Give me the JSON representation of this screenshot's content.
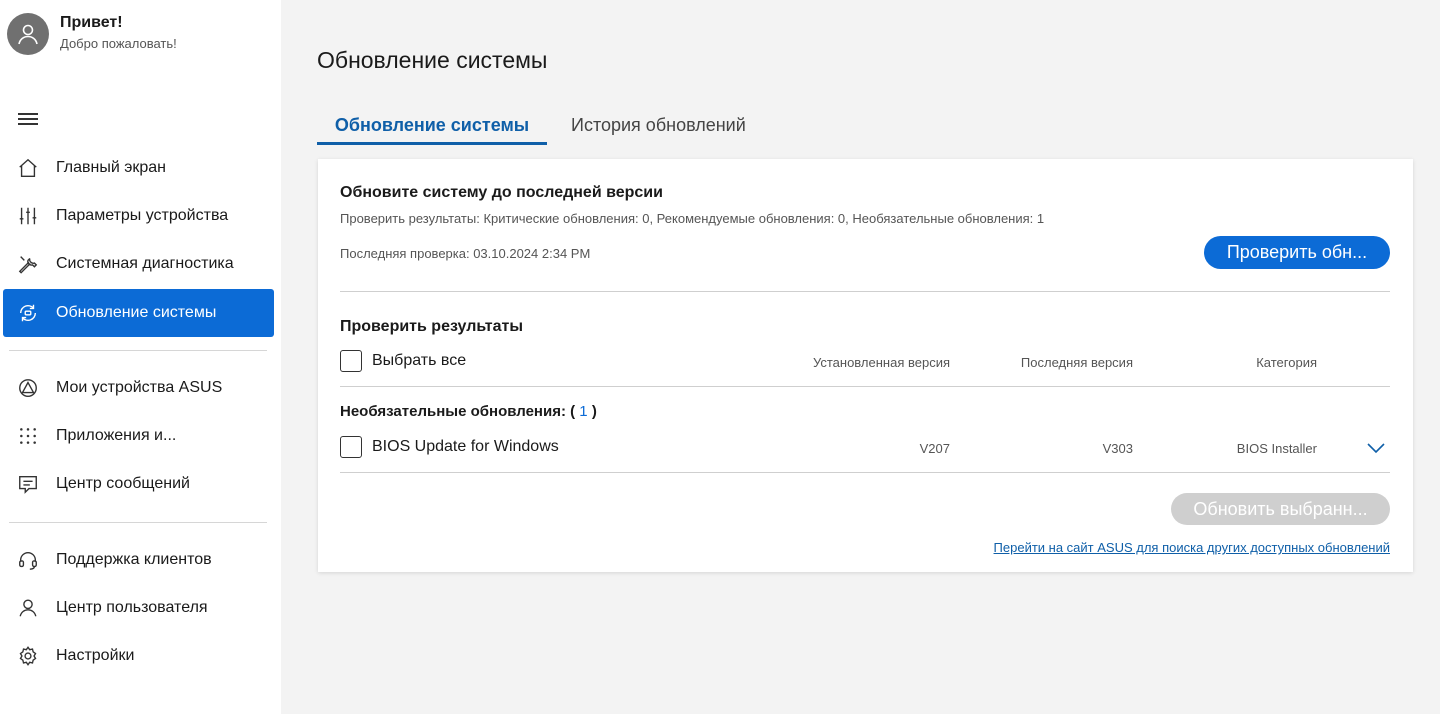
{
  "profile": {
    "greeting": "Привет!",
    "welcome": "Добро пожаловать!"
  },
  "sidebar": {
    "items": [
      {
        "label": "Главный экран",
        "icon": "home-icon"
      },
      {
        "label": "Параметры устройства",
        "icon": "sliders-icon"
      },
      {
        "label": "Системная диагностика",
        "icon": "wrench-icon"
      },
      {
        "label": "Обновление системы",
        "icon": "system-update-icon",
        "active": true
      },
      {
        "label": "Мои устройства ASUS",
        "icon": "asus-devices-icon"
      },
      {
        "label": "Приложения и...",
        "icon": "apps-grid-icon"
      },
      {
        "label": "Центр сообщений",
        "icon": "message-icon"
      },
      {
        "label": "Поддержка клиентов",
        "icon": "headset-icon"
      },
      {
        "label": "Центр пользователя",
        "icon": "user-icon"
      },
      {
        "label": "Настройки",
        "icon": "gear-icon"
      }
    ]
  },
  "main": {
    "title": "Обновление системы",
    "tabs": [
      {
        "label": "Обновление системы",
        "active": true
      },
      {
        "label": "История обновлений",
        "active": false
      }
    ],
    "card": {
      "title": "Обновите систему до последней версии",
      "subtitle": "Проверить результаты: Критические обновления: 0, Рекомендуемые обновления: 0, Необязательные обновления: 1",
      "last_check": "Последняя проверка: 03.10.2024   2:34 PM",
      "check_button": "Проверить обн...",
      "results_title": "Проверить результаты",
      "select_all": "Выбрать все",
      "columns": [
        "Установленная версия",
        "Последняя версия",
        "Категория"
      ],
      "optional_label": "Необязательные обновления: (",
      "optional_count": "1",
      "optional_close": ")",
      "updates": [
        {
          "name": "BIOS Update for Windows",
          "installed": "V207",
          "latest": "V303",
          "category": "BIOS Installer"
        }
      ],
      "update_button": "Обновить выбранн...",
      "link": "Перейти на сайт ASUS для поиска других доступных обновлений"
    }
  },
  "colors": {
    "accent": "#0c6bd6",
    "tab_active": "#0f5fa8",
    "disabled": "#cfcfcf"
  }
}
